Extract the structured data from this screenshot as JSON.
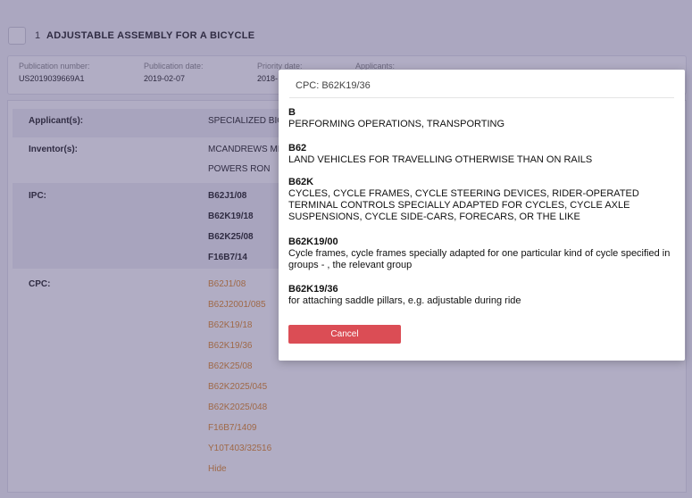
{
  "page": {
    "title_number": "1",
    "title": "ADJUSTABLE ASSEMBLY FOR A BICYCLE",
    "meta": {
      "publication_number_label": "Publication number:",
      "publication_number": "US2019039669A1",
      "publication_date_label": "Publication date:",
      "publication_date": "2019-02-07",
      "priority_date_label": "Priority date:",
      "priority_date": "2018-",
      "applicants_label": "Applicants:"
    },
    "details": {
      "applicant_label": "Applicant(s):",
      "applicant_value": "SPECIALIZED BIC",
      "inventor_label": "Inventor(s):",
      "inventors": [
        "MCANDREWS MI",
        "POWERS RON"
      ],
      "ipc_label": "IPC:",
      "ipc": [
        "B62J1/08",
        "B62K19/18",
        "B62K25/08",
        "F16B7/14"
      ],
      "cpc_label": "CPC:",
      "cpc": [
        "B62J1/08",
        "B62J2001/085",
        "B62K19/18",
        "B62K19/36",
        "B62K25/08",
        "B62K2025/045",
        "B62K2025/048",
        "F16B7/1409",
        "Y10T403/32516"
      ],
      "hide_label": "Hide"
    }
  },
  "modal": {
    "title": "CPC: B62K19/36",
    "entries": [
      {
        "code": "B",
        "desc": "PERFORMING OPERATIONS, TRANSPORTING"
      },
      {
        "code": "B62",
        "desc": "LAND VEHICLES FOR TRAVELLING OTHERWISE THAN ON RAILS"
      },
      {
        "code": "B62K",
        "desc": "CYCLES, CYCLE FRAMES, CYCLE STEERING DEVICES, RIDER-OPERATED TERMINAL CONTROLS SPECIALLY ADAPTED FOR CYCLES, CYCLE AXLE SUSPENSIONS, CYCLE SIDE-CARS, FORECARS, OR THE LIKE"
      },
      {
        "code": "B62K19/00",
        "desc": "Cycle frames, cycle frames specially adapted for one particular kind of cycle specified in groups  - , the relevant group"
      },
      {
        "code": "B62K19/36",
        "desc": "for attaching saddle pillars, e.g. adjustable during ride"
      }
    ],
    "cancel_label": "Cancel"
  },
  "colors": {
    "link": "#e08a2a",
    "cancel_button": "#db4d55",
    "overlay": "#463c73"
  }
}
